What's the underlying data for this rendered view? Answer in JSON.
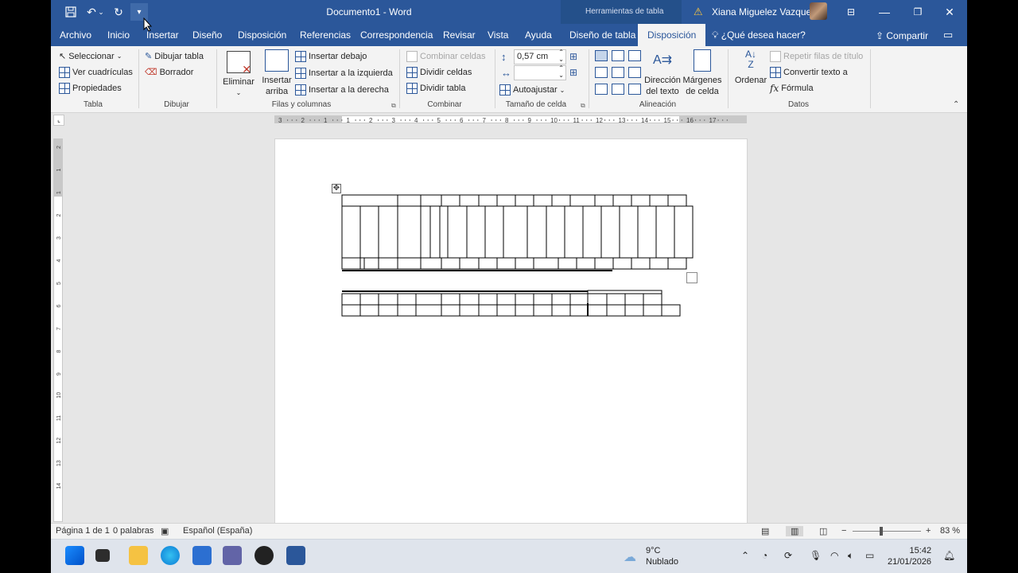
{
  "titlebar": {
    "doc_title": "Documento1  -  Word",
    "context_label": "Herramientas de tabla",
    "user_name": "Xiana Miguelez Vazquez"
  },
  "tabs": [
    {
      "label": "Archivo"
    },
    {
      "label": "Inicio"
    },
    {
      "label": "Insertar"
    },
    {
      "label": "Diseño"
    },
    {
      "label": "Disposición"
    },
    {
      "label": "Referencias"
    },
    {
      "label": "Correspondencia"
    },
    {
      "label": "Revisar"
    },
    {
      "label": "Vista"
    },
    {
      "label": "Ayuda"
    },
    {
      "label": "Diseño de tabla"
    },
    {
      "label": "Disposición"
    }
  ],
  "active_tab": "Disposición",
  "tellme": "¿Qué desea hacer?",
  "share": "Compartir",
  "ribbon": {
    "tabla": {
      "seleccionar": "Seleccionar",
      "ver_cuadriculas": "Ver cuadrículas",
      "propiedades": "Propiedades",
      "label": "Tabla"
    },
    "dibujar": {
      "dibujar_tabla": "Dibujar tabla",
      "borrador": "Borrador",
      "label": "Dibujar"
    },
    "filas": {
      "eliminar": "Eliminar",
      "insertar_arriba_1": "Insertar",
      "insertar_arriba_2": "arriba",
      "insertar_debajo": "Insertar debajo",
      "insertar_izquierda": "Insertar a la izquierda",
      "insertar_derecha": "Insertar a la derecha",
      "label": "Filas y columnas"
    },
    "combinar": {
      "combinar_celdas": "Combinar celdas",
      "dividir_celdas": "Dividir celdas",
      "dividir_tabla": "Dividir tabla",
      "label": "Combinar"
    },
    "tamano": {
      "height_value": "0,57 cm",
      "autoajustar": "Autoajustar",
      "label": "Tamaño de celda"
    },
    "alineacion": {
      "direccion_1": "Dirección",
      "direccion_2": "del texto",
      "margenes_1": "Márgenes",
      "margenes_2": "de celda",
      "label": "Alineación"
    },
    "datos": {
      "ordenar": "Ordenar",
      "repetir": "Repetir filas de título",
      "convertir": "Convertir texto a",
      "formula": "Fórmula",
      "label": "Datos"
    }
  },
  "hruler_ticks": [
    "3",
    "2",
    "1",
    "1",
    "2",
    "3",
    "4",
    "5",
    "6",
    "7",
    "8",
    "9",
    "10",
    "11",
    "12",
    "13",
    "14",
    "15",
    "16",
    "17"
  ],
  "vruler_ticks": [
    "2",
    "1",
    "1",
    "2",
    "3",
    "4",
    "5",
    "6",
    "7",
    "8",
    "9",
    "10",
    "11",
    "12",
    "13",
    "14"
  ],
  "statusbar": {
    "page": "Página 1 de 1",
    "words": "0 palabras",
    "language": "Español (España)",
    "zoom": "83 %"
  },
  "taskbar": {
    "temperature": "9°C",
    "condition": "Nublado",
    "time": "15:42",
    "date": "21/01/2026"
  }
}
